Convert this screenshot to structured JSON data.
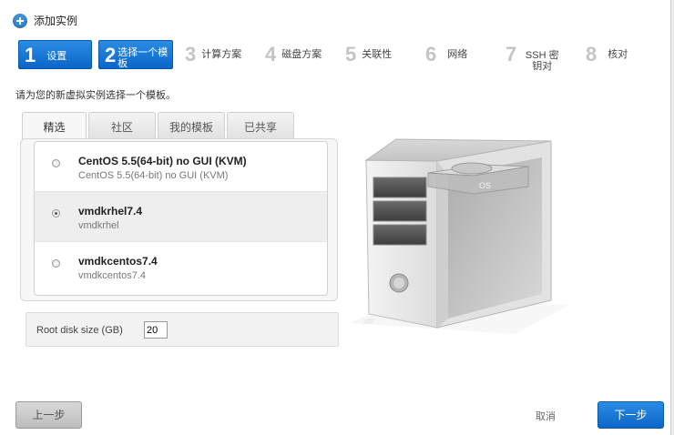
{
  "dialog": {
    "title": "添加实例"
  },
  "steps": [
    {
      "number": "1",
      "label": "设置"
    },
    {
      "number": "2",
      "label": "选择一个模板"
    },
    {
      "number": "3",
      "label": "计算方案"
    },
    {
      "number": "4",
      "label": "磁盘方案"
    },
    {
      "number": "5",
      "label": "关联性"
    },
    {
      "number": "6",
      "label": "网络"
    },
    {
      "number": "7",
      "label": "SSH 密钥对"
    },
    {
      "number": "8",
      "label": "核对"
    }
  ],
  "prompt": "请为您的新虚拟实例选择一个模板。",
  "tabs": [
    {
      "label": "精选"
    },
    {
      "label": "社区"
    },
    {
      "label": "我的模板"
    },
    {
      "label": "已共享"
    }
  ],
  "templates": [
    {
      "name": "CentOS 5.5(64-bit) no GUI (KVM)",
      "description": "CentOS 5.5(64-bit) no GUI (KVM)"
    },
    {
      "name": "vmdkrhel7.4",
      "description": "vmdkrhel"
    },
    {
      "name": "vmdkcentos7.4",
      "description": "vmdkcentos7.4"
    }
  ],
  "selected_template": "vmdkrhel7.4",
  "disk": {
    "label": "Root disk size (GB)",
    "value": "20"
  },
  "illustration": {
    "os_label": "OS"
  },
  "buttons": {
    "back": "上一步",
    "cancel": "取消",
    "next": "下一步"
  },
  "colors": {
    "accent": "#0b66c8",
    "selected_row": "#eeeeee"
  }
}
